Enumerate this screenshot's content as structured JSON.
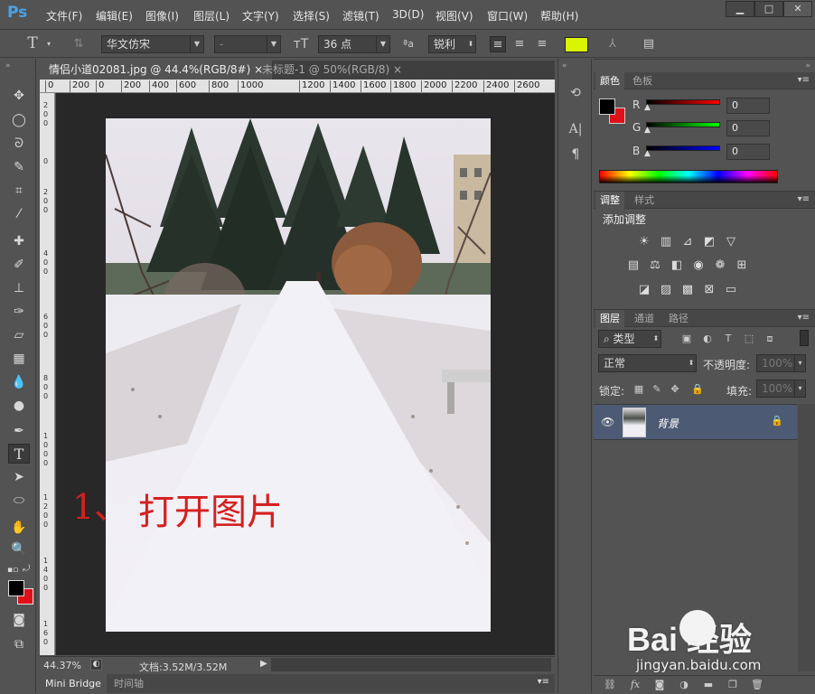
{
  "app": {
    "logo": "Ps"
  },
  "menu": [
    "文件(F)",
    "编辑(E)",
    "图像(I)",
    "图层(L)",
    "文字(Y)",
    "选择(S)",
    "滤镜(T)",
    "3D(D)",
    "视图(V)",
    "窗口(W)",
    "帮助(H)"
  ],
  "window_controls": [
    "▁",
    "□",
    "✕"
  ],
  "options": {
    "font_family": "华文仿宋",
    "font_style": "-",
    "font_size": "36 点",
    "antialias": "锐利",
    "text_color": "#d9f500"
  },
  "tabs": [
    {
      "label": "情侣小道02081.jpg @ 44.4%(RGB/8#)",
      "close": "×"
    },
    {
      "label": "未标题-1 @ 50%(RGB/8)",
      "close": "×"
    }
  ],
  "ruler_h": [
    "0",
    "200",
    "0",
    "200",
    "400",
    "600",
    "800",
    "1000",
    "1200",
    "1400",
    "1600",
    "1800",
    "2000",
    "2200",
    "2400",
    "2600"
  ],
  "annotation": {
    "number": "1、",
    "text": "打开图片"
  },
  "status": {
    "zoom": "44.37%",
    "doc": "文档:3.52M/3.52M"
  },
  "bottom_tabs": [
    "Mini Bridge",
    "时间轴"
  ],
  "color_panel": {
    "tabs": [
      "颜色",
      "色板"
    ],
    "channels": [
      {
        "label": "R",
        "value": "0",
        "gradient": "linear-gradient(to right,#000,#ff0000)"
      },
      {
        "label": "G",
        "value": "0",
        "gradient": "linear-gradient(to right,#000,#00ff00)"
      },
      {
        "label": "B",
        "value": "0",
        "gradient": "linear-gradient(to right,#000,#0000ff)"
      }
    ],
    "foreground": "#000000",
    "background": "#e0101b"
  },
  "adjust_panel": {
    "tabs": [
      "调整",
      "样式"
    ],
    "title": "添加调整"
  },
  "layers_panel": {
    "tabs": [
      "图层",
      "通道",
      "路径"
    ],
    "filter_label": "类型",
    "blend_mode": "正常",
    "opacity_label": "不透明度:",
    "opacity_value": "100%",
    "lock_label": "锁定:",
    "fill_label": "填充:",
    "fill_value": "100%",
    "layers": [
      {
        "name": "背景",
        "locked": true,
        "visible": true
      }
    ]
  },
  "watermark": {
    "brand": "Bai  经验",
    "url": "jingyan.baidu.com"
  }
}
